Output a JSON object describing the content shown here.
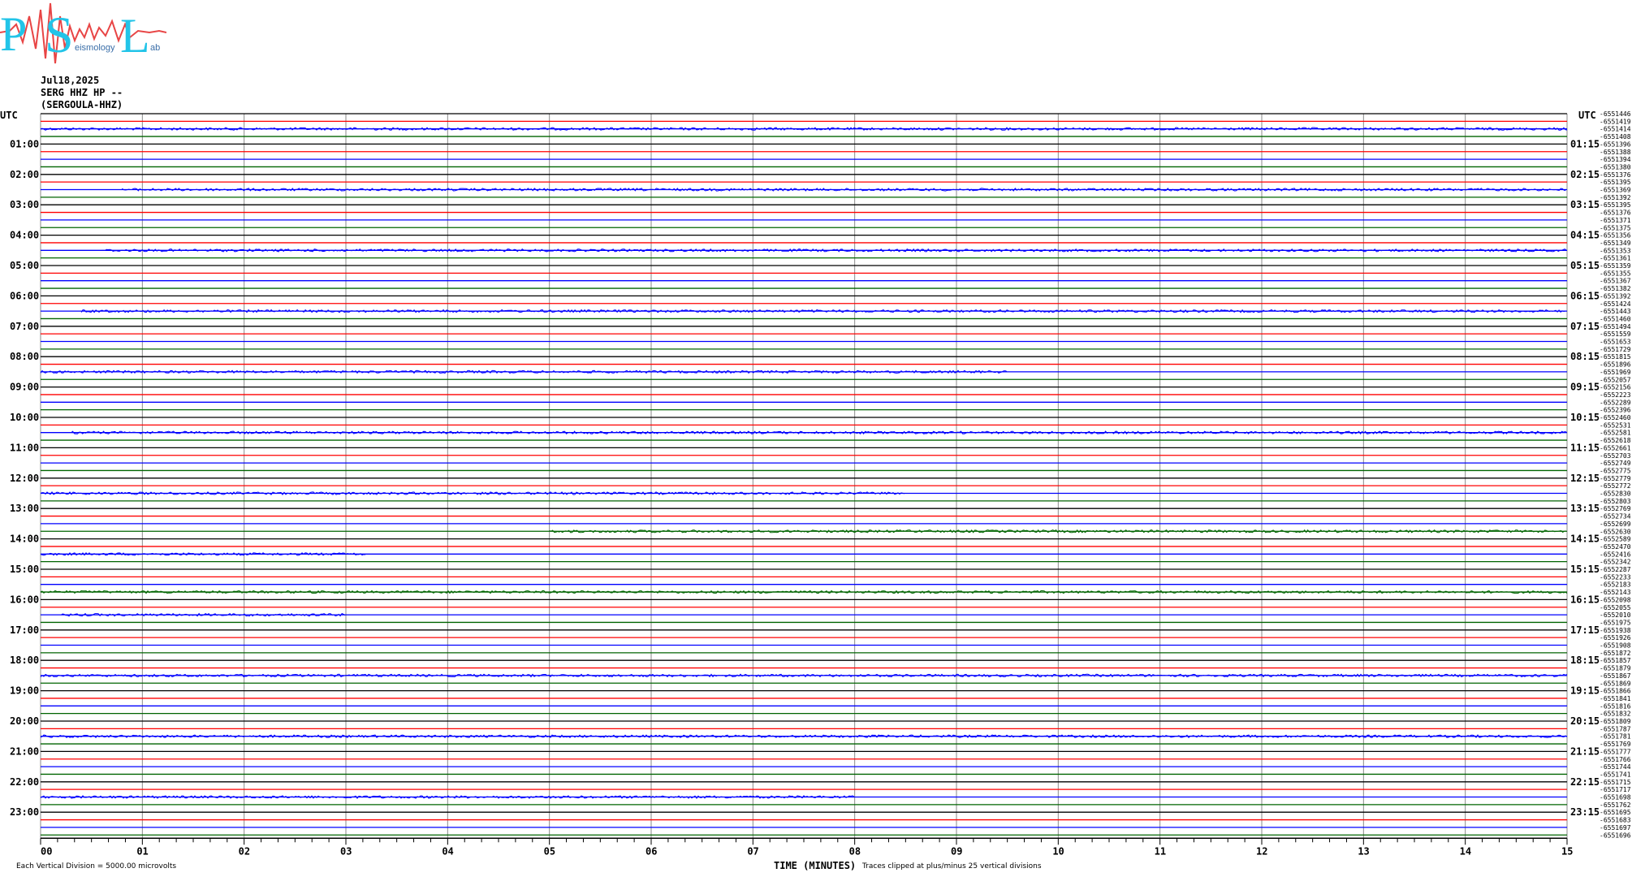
{
  "logo": {
    "letters": [
      "P",
      "S",
      "L"
    ],
    "small_words": [
      "",
      "eismology",
      "ab"
    ],
    "letter_color": "#22c4e8",
    "wave_color": "#e84545"
  },
  "header": {
    "date": "Jul18,2025",
    "station": "SERG HHZ HP --",
    "code": "(SERGOULA-HHZ)"
  },
  "chart_data": {
    "type": "line",
    "title": "",
    "left_axis_label": "UTC",
    "right_axis_label": "UTC",
    "xlabel": "TIME (MINUTES)",
    "x_ticks": [
      "00",
      "01",
      "02",
      "03",
      "04",
      "05",
      "06",
      "07",
      "08",
      "09",
      "10",
      "11",
      "12",
      "13",
      "14",
      "15"
    ],
    "xlim": [
      0,
      15
    ],
    "rows_per_hour": 4,
    "row_minutes": 15,
    "trace_colors": [
      "#000000",
      "#ff0000",
      "#0000ff",
      "#006400"
    ],
    "grid_color": "#8a8a8a",
    "left_hour_labels": [
      "01:00",
      "02:00",
      "03:00",
      "04:00",
      "05:00",
      "06:00",
      "07:00",
      "08:00",
      "09:00",
      "10:00",
      "11:00",
      "12:00",
      "13:00",
      "14:00",
      "15:00",
      "16:00",
      "17:00",
      "18:00",
      "19:00",
      "20:00",
      "21:00",
      "22:00",
      "23:00"
    ],
    "right_hour_labels": [
      "01:15",
      "02:15",
      "03:15",
      "04:15",
      "05:15",
      "06:15",
      "07:15",
      "08:15",
      "09:15",
      "10:15",
      "11:15",
      "12:15",
      "13:15",
      "14:15",
      "15:15",
      "16:15",
      "17:15",
      "18:15",
      "19:15",
      "20:15",
      "21:15",
      "22:15",
      "23:15"
    ],
    "right_values": [
      "-6551419",
      "-6551414",
      "-6551408",
      "-6551396",
      "-6551388",
      "-6551394",
      "-6551380",
      "-6551376",
      "-6551395",
      "-6551369",
      "-6551392",
      "-6551395",
      "-6551376",
      "-6551371",
      "-6551375",
      "-6551356",
      "-6551349",
      "-6551353",
      "-6551361",
      "-6551359",
      "-6551355",
      "-6551367",
      "-6551382",
      "-6551392",
      "-6551424",
      "-6551443",
      "-6551460",
      "-6551494",
      "-6551559",
      "-6551653",
      "-6551729",
      "-6551815",
      "-6551896",
      "-6551969",
      "-6552057",
      "-6552156",
      "-6552223",
      "-6552289",
      "-6552396",
      "-6552460",
      "-6552531",
      "-6552581",
      "-6552618",
      "-6552661",
      "-6552703",
      "-6552749",
      "-6552775",
      "-6552779",
      "-6552772",
      "-6552830",
      "-6552803",
      "-6552769",
      "-6552734",
      "-6552699",
      "-6552630",
      "-6552589",
      "-6552470",
      "-6552416",
      "-6552342",
      "-6552287",
      "-6552233",
      "-6552183",
      "-6552143",
      "-6552098",
      "-6552055",
      "-6552010",
      "-6551975",
      "-6551938",
      "-6551926",
      "-6551908",
      "-6551872",
      "-6551857",
      "-6551879",
      "-6551867",
      "-6551869",
      "-6551866",
      "-6551841",
      "-6551816",
      "-6551832",
      "-6551809",
      "-6551787",
      "-6551781",
      "-6551769",
      "-6551777",
      "-6551766",
      "-6551744",
      "-6551741",
      "-6551715",
      "-6551717",
      "-6551698",
      "-6551762",
      "-6551695",
      "-6551683",
      "-6551697",
      "-6551696"
    ],
    "top_right_value": "-6551446",
    "noisy_rows": {
      "2": [
        0.0,
        15.0
      ],
      "10": [
        0.8,
        15.0
      ],
      "18": [
        0.6,
        15.0
      ],
      "26": [
        0.4,
        15.0
      ],
      "34": [
        0.0,
        9.5
      ],
      "42": [
        0.3,
        15.0
      ],
      "50": [
        0.0,
        8.5
      ],
      "55": [
        5.0,
        15.0
      ],
      "58": [
        0.0,
        3.2
      ],
      "63": [
        0.0,
        15.0
      ],
      "66": [
        0.2,
        3.0
      ],
      "74": [
        0.0,
        15.0
      ],
      "82": [
        0.0,
        15.0
      ],
      "90": [
        0.0,
        8.0
      ]
    },
    "footer_left": "Each Vertical Division = 5000.00 microvolts",
    "footer_right": "Traces clipped at plus/minus 25 vertical divisions"
  }
}
